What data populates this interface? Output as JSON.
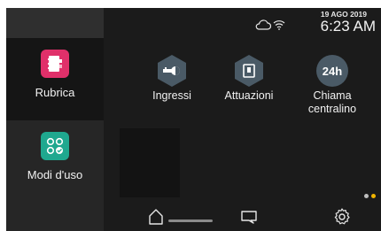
{
  "status": {
    "date": "19 AGO 2019",
    "time": "6:23 AM",
    "icons": [
      "cloud-icon",
      "wifi-icon"
    ]
  },
  "sidebar": {
    "items": [
      {
        "label": "Rubrica",
        "icon": "address-book-icon",
        "color": "#e0306a",
        "selected": true
      },
      {
        "label": "Modi d'uso",
        "icon": "modes-icon",
        "color": "#1fa88f",
        "selected": false
      }
    ]
  },
  "main": {
    "tiles": [
      {
        "label": "Ingressi",
        "icon": "key-icon"
      },
      {
        "label": "Attuazioni",
        "icon": "actuator-icon"
      },
      {
        "label": "Chiama centralino",
        "icon": "24h-icon",
        "icon_text": "24h"
      }
    ]
  },
  "bottom": {
    "buttons": [
      "home-icon",
      "message-icon",
      "settings-icon"
    ],
    "page_dots": {
      "count": 2,
      "active_index": 1,
      "active_color": "#f0b400",
      "inactive_color": "#bfbfbf"
    }
  },
  "colors": {
    "background": "#1b1b1b",
    "sidebar": "#262626",
    "hex_tile": "#4a5a66"
  }
}
